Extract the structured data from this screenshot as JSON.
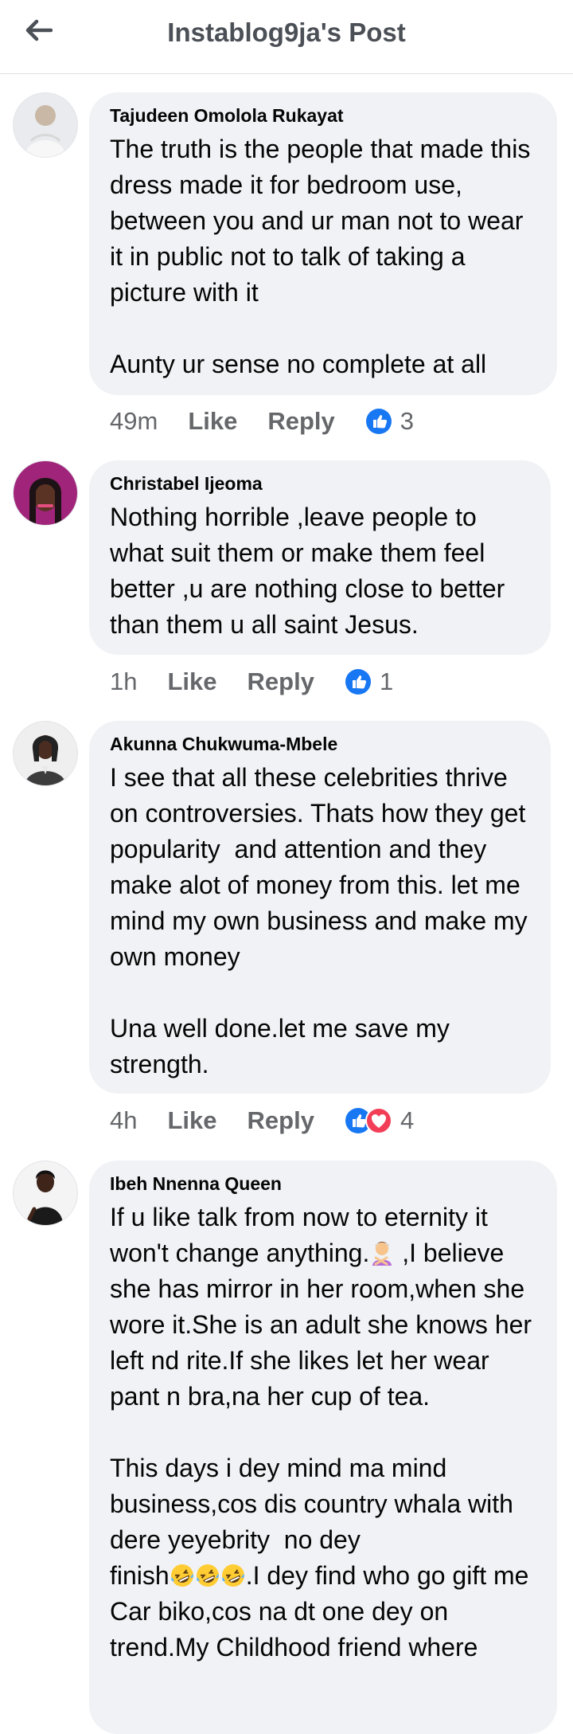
{
  "header": {
    "title": "Instablog9ja's Post"
  },
  "comments": [
    {
      "author": "Tajudeen Omolola Rukayat",
      "text": "The truth is the people that made this dress made it for bedroom use, between you and ur man not to wear it in public not to talk of taking a picture with it\n\nAunty ur sense no complete at all",
      "time": "49m",
      "like": "Like",
      "reply": "Reply",
      "reactions": [
        "like"
      ],
      "count": "3"
    },
    {
      "author": "Christabel Ijeoma",
      "text": "Nothing horrible ,leave people to what suit them or make them feel better ,u are nothing close to better than them u all saint Jesus.",
      "time": "1h",
      "like": "Like",
      "reply": "Reply",
      "reactions": [
        "like"
      ],
      "count": "1"
    },
    {
      "author": "Akunna Chukwuma-Mbele",
      "text": "I see that all these celebrities thrive on controversies. Thats how they get popularity  and attention and they make alot of money from this. let me mind my own business and make my own money\n\nUna well done.let me save my strength.",
      "time": "4h",
      "like": "Like",
      "reply": "Reply",
      "reactions": [
        "like",
        "love"
      ],
      "count": "4"
    },
    {
      "author": "Ibeh Nnenna Queen",
      "text_lines": {
        "l1": "If u like talk from now to eternity it",
        "l2a": "won't change anything.",
        "l2b": " ,I believe",
        "l3": "she has mirror in her room,when she wore it.She is an adult she knows her left nd rite.If she likes let her wear pant n bra,na her cup of tea.",
        "l4": "This days i dey mind ma mind business,cos dis country whala with dere yeyebrity  no dey",
        "l5a": "finish",
        "l5b": ".I dey find who go gift me Car biko,cos na dt one dey on trend.My Childhood friend where"
      },
      "emoji": {
        "woman_gesturing": "woman-gesturing-no-emoji",
        "laughing": "rolling-laughing-emoji"
      }
    }
  ],
  "colors": {
    "like_blue": "#1877f2",
    "love_red": "#f33e58",
    "bubble_bg": "#f0f2f5",
    "meta_gray": "#65676b"
  }
}
